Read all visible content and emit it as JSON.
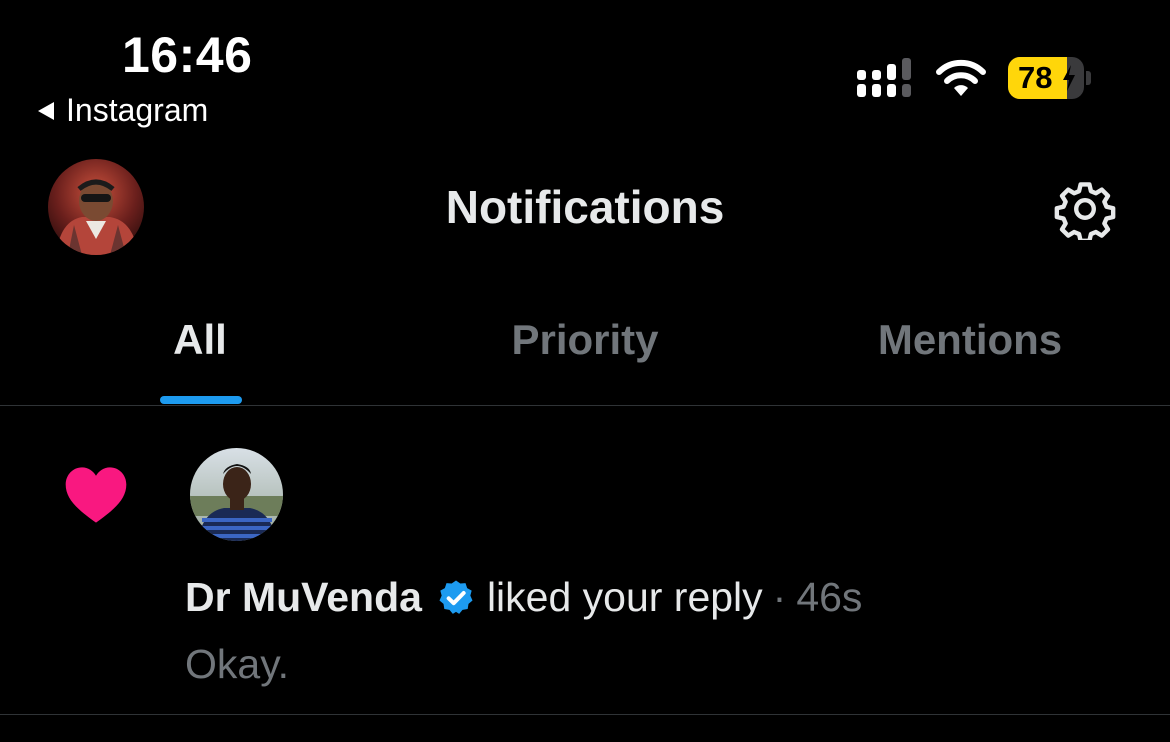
{
  "status_bar": {
    "time": "16:46",
    "back_app": "Instagram",
    "battery_percent": "78",
    "battery_level": 0.78,
    "battery_charging": true
  },
  "header": {
    "title": "Notifications",
    "icon": "gear-icon"
  },
  "tabs": [
    {
      "label": "All",
      "active": true
    },
    {
      "label": "Priority",
      "active": false
    },
    {
      "label": "Mentions",
      "active": false
    }
  ],
  "notifications": [
    {
      "type": "like",
      "icon": "heart-icon",
      "user": "Dr MuVenda",
      "verified": true,
      "action": "liked your reply",
      "separator": "·",
      "time": "46s",
      "snippet": "Okay."
    }
  ],
  "colors": {
    "background": "#000000",
    "accent": "#1d9bf0",
    "like": "#f91880",
    "battery": "#ffd60a",
    "muted": "#71767b"
  }
}
